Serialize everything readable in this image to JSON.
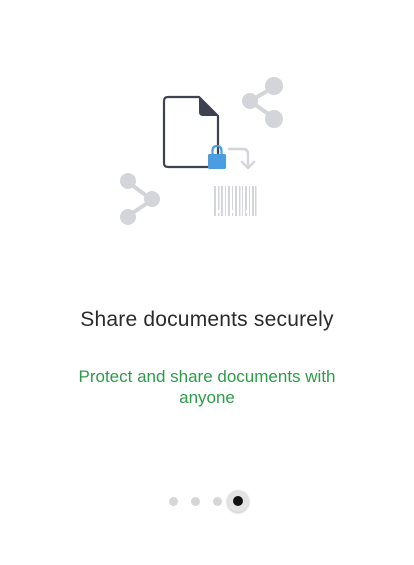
{
  "onboarding": {
    "title": "Share documents securely",
    "subtitle": "Protect and share documents with anyone",
    "pager": {
      "total_pages": 4,
      "active_page": 4
    }
  },
  "icons": {
    "document": "document-icon",
    "lock": "lock-icon",
    "share_top": "share-icon",
    "share_left": "share-icon",
    "arrow": "curved-arrow-icon",
    "barcode": "barcode-icon"
  },
  "colors": {
    "title": "#2b2b2b",
    "subtitle": "#2e9b4a",
    "lock": "#4a9ee0",
    "document_stroke": "#3d4150",
    "illustration_gray": "#d3d5db",
    "dot_inactive": "#d6d6d6",
    "dot_active": "#111111"
  }
}
